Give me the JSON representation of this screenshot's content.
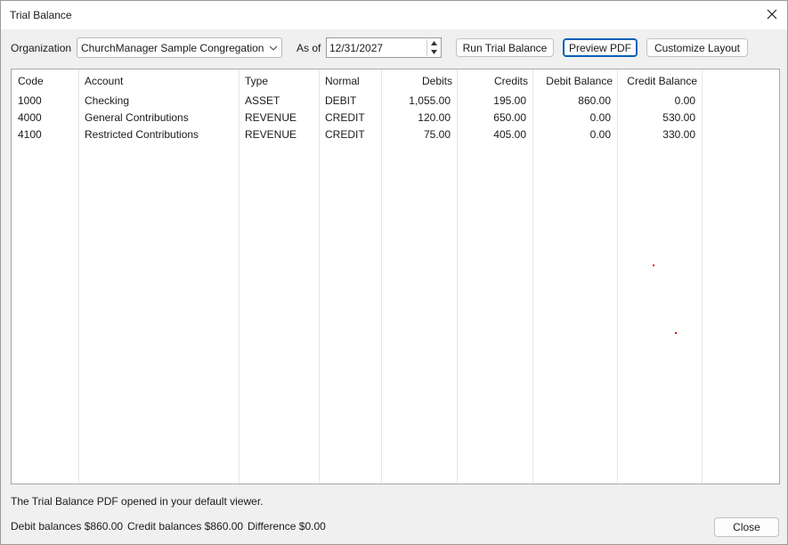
{
  "window": {
    "title": "Trial Balance"
  },
  "toolbar": {
    "organization_label": "Organization",
    "organization_value": "ChurchManager Sample Congregation",
    "as_of_label": "As of",
    "as_of_value": "12/31/2027",
    "run_label": "Run Trial Balance",
    "preview_label": "Preview PDF",
    "customize_label": "Customize Layout"
  },
  "table": {
    "headers": {
      "code": "Code",
      "account": "Account",
      "type": "Type",
      "normal": "Normal",
      "debits": "Debits",
      "credits": "Credits",
      "debit_balance": "Debit Balance",
      "credit_balance": "Credit Balance"
    },
    "rows": [
      {
        "code": "1000",
        "account": "Checking",
        "type": "ASSET",
        "normal": "DEBIT",
        "debits": "1,055.00",
        "credits": "195.00",
        "debit_balance": "860.00",
        "credit_balance": "0.00"
      },
      {
        "code": "4000",
        "account": "General Contributions",
        "type": "REVENUE",
        "normal": "CREDIT",
        "debits": "120.00",
        "credits": "650.00",
        "debit_balance": "0.00",
        "credit_balance": "530.00"
      },
      {
        "code": "4100",
        "account": "Restricted Contributions",
        "type": "REVENUE",
        "normal": "CREDIT",
        "debits": "75.00",
        "credits": "405.00",
        "debit_balance": "0.00",
        "credit_balance": "330.00"
      }
    ]
  },
  "status": {
    "message": "The Trial Balance PDF opened in your default viewer."
  },
  "footer": {
    "debit_balances": "Debit balances $860.00",
    "credit_balances": "Credit balances $860.00",
    "difference": "Difference $0.00",
    "close_label": "Close"
  },
  "icons": {
    "close": "close-icon",
    "dropdown": "chevron-down-icon",
    "spin_up": "spin-up-icon",
    "spin_down": "spin-down-icon"
  },
  "colors": {
    "default_button_border": "#005fb8",
    "grid_background": "#ffffff",
    "window_background": "#f0f0f0"
  }
}
